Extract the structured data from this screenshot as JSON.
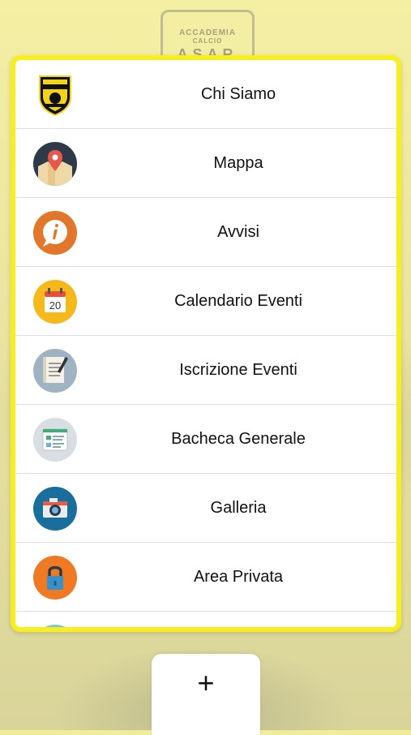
{
  "background": {
    "crest_line1": "ACCADEMIA",
    "crest_line2": "CALCIO",
    "crest_line3": "ASAR"
  },
  "menu": {
    "items": [
      {
        "label": "Chi Siamo",
        "icon": "club-logo-icon"
      },
      {
        "label": "Mappa",
        "icon": "map-pin-icon"
      },
      {
        "label": "Avvisi",
        "icon": "info-bubble-icon"
      },
      {
        "label": "Calendario Eventi",
        "icon": "calendar-icon",
        "icon_text": "20"
      },
      {
        "label": "Iscrizione Eventi",
        "icon": "document-pen-icon"
      },
      {
        "label": "Bacheca Generale",
        "icon": "board-icon"
      },
      {
        "label": "Galleria",
        "icon": "camera-icon"
      },
      {
        "label": "Area Privata",
        "icon": "lock-icon"
      }
    ]
  },
  "fab": {
    "label": "+"
  },
  "colors": {
    "panel_border": "#f7ee1e",
    "background": "#f1ec9a"
  }
}
